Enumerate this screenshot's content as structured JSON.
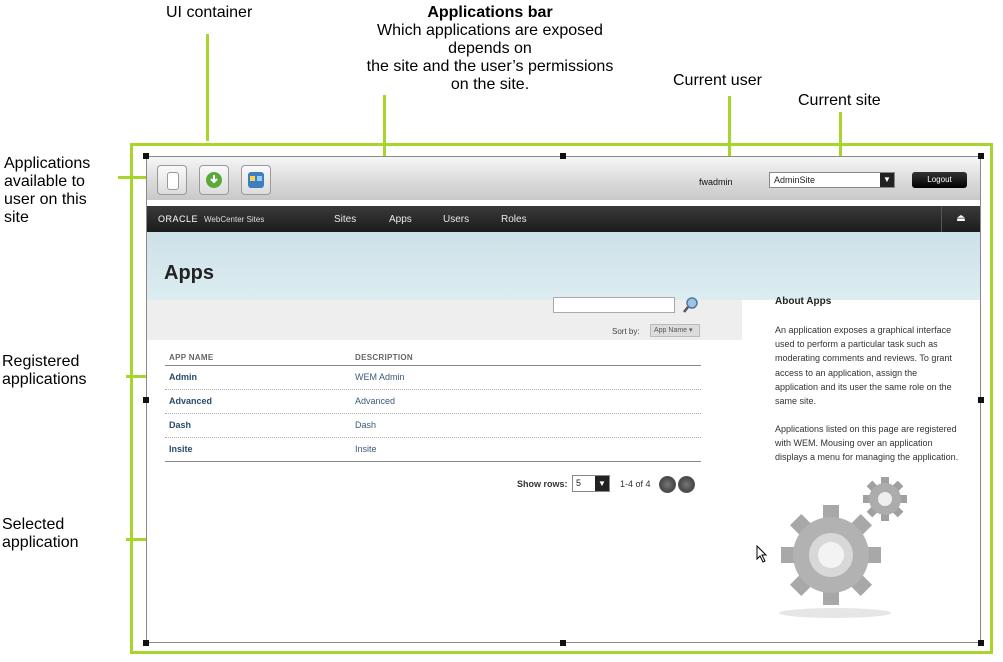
{
  "callouts": {
    "ui_container": "UI container",
    "apps_bar_title": "Applications bar",
    "apps_bar_desc_1": "Which applications are exposed",
    "apps_bar_desc_2": "depends on",
    "apps_bar_desc_3": "the site and the user’s permissions",
    "apps_bar_desc_4": "on the site.",
    "current_user": "Current user",
    "current_site": "Current site",
    "apps_available_1": "Applications",
    "apps_available_2": "available to",
    "apps_available_3": "user on this",
    "apps_available_4": "site",
    "registered_1": "Registered",
    "registered_2": "applications",
    "selected_1": "Selected",
    "selected_2": "application"
  },
  "app_bar": {
    "app_icons": [
      "admin-app-icon",
      "download-app-icon",
      "dashboard-app-icon"
    ],
    "username": "fwadmin",
    "site_selected": "AdminSite",
    "logout_label": "Logout"
  },
  "nav": {
    "brand": "ORACLE",
    "brand_sub": "WebCenter Sites",
    "items": [
      "Sites",
      "Apps",
      "Users",
      "Roles"
    ]
  },
  "page": {
    "title": "Apps",
    "sort_label": "Sort by:",
    "sort_value": "App Name ▾"
  },
  "table": {
    "headers": [
      "APP NAME",
      "DESCRIPTION"
    ],
    "rows": [
      {
        "name": "Admin",
        "description": "WEM Admin"
      },
      {
        "name": "Advanced",
        "description": "Advanced"
      },
      {
        "name": "Dash",
        "description": "Dash"
      },
      {
        "name": "Insite",
        "description": "Insite"
      }
    ]
  },
  "pagination": {
    "show_rows_label": "Show rows:",
    "rows_value": "5",
    "page_info": "1-4 of 4"
  },
  "about": {
    "title": "About Apps",
    "paragraph_1_lines": [
      "An application exposes a graphical interface",
      "used to perform a particular task such as",
      "moderating comments and reviews. To grant",
      "access to an application, assign the",
      "application and its user the same role on the",
      "same site."
    ],
    "paragraph_2_lines": [
      "Applications listed on this page are registered",
      "with WEM. Mousing over an application",
      "displays a menu for managing the application."
    ]
  },
  "colors": {
    "callout_line": "#a8d52b",
    "nav_bg": "#1c1c1c",
    "band_bg": "#cde1e8",
    "link": "#2b4a6b"
  }
}
